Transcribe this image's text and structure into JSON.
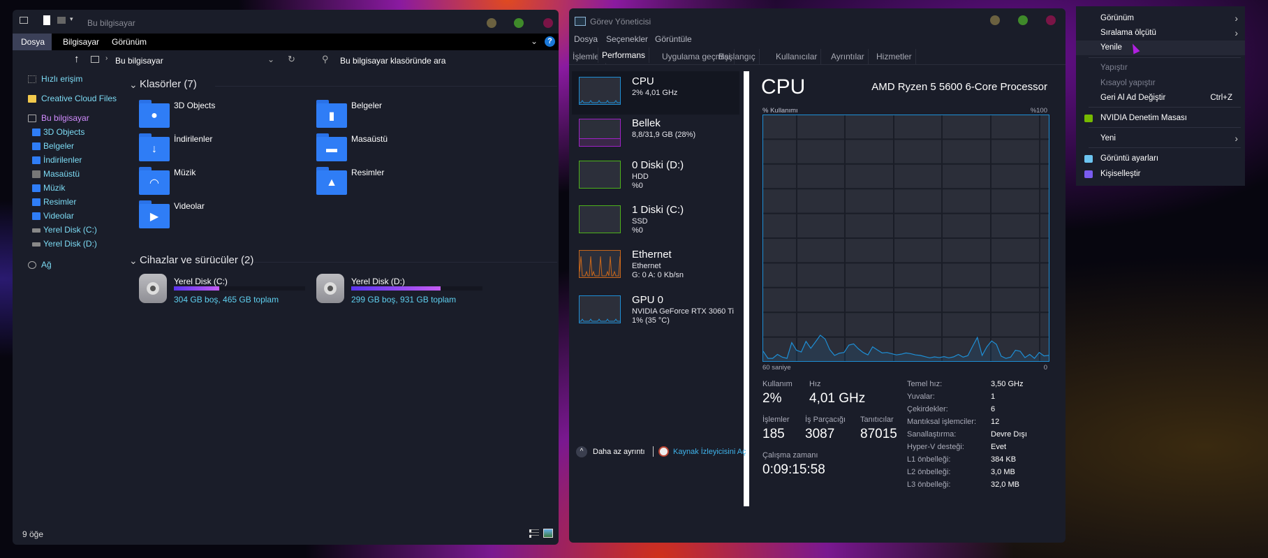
{
  "explorer": {
    "title": "Bu bilgisayar",
    "ribbon_tabs": [
      "Dosya",
      "Bilgisayar",
      "Görünüm"
    ],
    "address": "Bu bilgisayar",
    "search_placeholder": "Bu bilgisayar klasöründe ara",
    "nav": [
      {
        "label": "Hızlı erişim",
        "icon": "quick-access-icon"
      },
      {
        "label": "Creative Cloud Files",
        "icon": "creative-cloud-icon"
      },
      {
        "label": "Bu bilgisayar",
        "icon": "computer-icon"
      },
      {
        "label": "3D Objects",
        "icon": "3d-objects-icon"
      },
      {
        "label": "Belgeler",
        "icon": "documents-icon"
      },
      {
        "label": "İndirilenler",
        "icon": "downloads-icon"
      },
      {
        "label": "Masaüstü",
        "icon": "desktop-icon"
      },
      {
        "label": "Müzik",
        "icon": "music-icon"
      },
      {
        "label": "Resimler",
        "icon": "pictures-icon"
      },
      {
        "label": "Videolar",
        "icon": "videos-icon"
      },
      {
        "label": "Yerel Disk (C:)",
        "icon": "drive-icon"
      },
      {
        "label": "Yerel Disk (D:)",
        "icon": "drive-icon"
      },
      {
        "label": "Ağ",
        "icon": "network-icon"
      }
    ],
    "folders_header": "Klasörler (7)",
    "folders": [
      "3D Objects",
      "Belgeler",
      "İndirilenler",
      "Masaüstü",
      "Müzik",
      "Resimler",
      "Videolar"
    ],
    "drives_header": "Cihazlar ve sürücüler (2)",
    "drives": [
      {
        "name": "Yerel Disk (C:)",
        "info": "304 GB boş, 465 GB toplam",
        "used_percent": 34.6
      },
      {
        "name": "Yerel Disk (D:)",
        "info": "299 GB boş, 931 GB toplam",
        "used_percent": 67.9
      }
    ],
    "status": "9 öğe"
  },
  "taskmgr": {
    "title": "Görev Yöneticisi",
    "menu": [
      "Dosya",
      "Seçenekler",
      "Görüntüle"
    ],
    "tabs": [
      "İşlemler",
      "Performans",
      "Uygulama geçmişi",
      "Başlangıç",
      "Kullanıcılar",
      "Ayrıntılar",
      "Hizmetler"
    ],
    "active_tab": "Performans",
    "sidebar": [
      {
        "name": "CPU",
        "lines": [
          "2% 4,01 GHz"
        ],
        "color": "#1e8fd6"
      },
      {
        "name": "Bellek",
        "lines": [
          "8,8/31,9 GB (28%)"
        ],
        "color": "#a021c8"
      },
      {
        "name": "0 Diski (D:)",
        "lines": [
          "HDD",
          "%0"
        ],
        "color": "#4db31a"
      },
      {
        "name": "1 Diski (C:)",
        "lines": [
          "SSD",
          "%0"
        ],
        "color": "#4db31a"
      },
      {
        "name": "Ethernet",
        "lines": [
          "Ethernet",
          "G: 0 A: 0 Kb/sn"
        ],
        "color": "#c8661a"
      },
      {
        "name": "GPU 0",
        "lines": [
          "NVIDIA GeForce RTX 3060 Ti",
          "1%  (35 °C)"
        ],
        "color": "#1e8fd6"
      }
    ],
    "main": {
      "title": "CPU",
      "model": "AMD Ryzen 5 5600 6-Core Processor",
      "y_label": "% Kullanımı",
      "y_max_label": "%100",
      "x_left_label": "60 saniye",
      "x_right_label": "0",
      "stats": [
        {
          "label": "Kullanım",
          "value": "2%"
        },
        {
          "label": "Hız",
          "value": "4,01 GHz"
        },
        {
          "label": "İşlemler",
          "value": "185"
        },
        {
          "label": "İş Parçacığı",
          "value": "3087"
        },
        {
          "label": "Tanıtıcılar",
          "value": "87015"
        },
        {
          "label": "Çalışma zamanı",
          "value": "0:09:15:58"
        }
      ],
      "details": [
        [
          "Temel hız:",
          "3,50 GHz"
        ],
        [
          "Yuvalar:",
          "1"
        ],
        [
          "Çekirdekler:",
          "6"
        ],
        [
          "Mantıksal işlemciler:",
          "12"
        ],
        [
          "Sanallaştırma:",
          "Devre Dışı"
        ],
        [
          "Hyper-V desteği:",
          "Evet"
        ],
        [
          "L1 önbelleği:",
          "384 KB"
        ],
        [
          "L2 önbelleği:",
          "3,0 MB"
        ],
        [
          "L3 önbelleği:",
          "32,0 MB"
        ]
      ]
    },
    "footer": {
      "less_details": "Daha az ayrıntı",
      "resource_monitor": "Kaynak İzleyicisini Aç"
    }
  },
  "context_menu": {
    "items": [
      {
        "label": "Görünüm",
        "submenu": true
      },
      {
        "label": "Sıralama ölçütü",
        "submenu": true
      },
      {
        "label": "Yenile",
        "highlighted": true
      },
      {
        "label": "Yapıştır",
        "disabled": true
      },
      {
        "label": "Kısayol yapıştır",
        "disabled": true
      },
      {
        "label": "Geri Al Ad Değiştir",
        "shortcut": "Ctrl+Z"
      },
      {
        "label": "NVIDIA Denetim Masası",
        "icon": "nvidia-icon"
      },
      {
        "label": "Yeni",
        "submenu": true
      },
      {
        "label": "Görüntü ayarları",
        "icon": "display-settings-icon"
      },
      {
        "label": "Kişiselleştir",
        "icon": "personalize-icon"
      }
    ]
  },
  "chart_data": {
    "type": "line",
    "ylabel": "% Kullanımı",
    "ylim": [
      0,
      100
    ],
    "xlim": [
      60,
      0
    ],
    "grid": true,
    "x_labels": [
      "60 saniye",
      "0"
    ],
    "values": [
      4.0,
      1.1,
      1.1,
      2.7,
      1.6,
      1.1,
      7.5,
      4.4,
      3.7,
      8.0,
      5.2,
      7.8,
      10.5,
      9.0,
      4.6,
      2.3,
      3.2,
      3.5,
      6.5,
      7.0,
      5.0,
      3.5,
      2.5,
      5.8,
      4.5,
      3.3,
      3.5,
      3.0,
      2.5,
      2.8,
      3.3,
      3.0,
      2.5,
      2.3,
      1.8,
      1.3,
      1.7,
      1.4,
      1.8,
      1.3,
      1.7,
      2.7,
      1.6,
      2.2,
      6.0,
      9.6,
      2.3,
      5.8,
      8.2,
      6.8,
      2.0,
      1.1,
      1.6,
      4.4,
      4.0,
      1.4,
      2.7,
      1.1,
      3.5,
      2.1,
      2.3
    ],
    "color": "#1e8fd6"
  }
}
